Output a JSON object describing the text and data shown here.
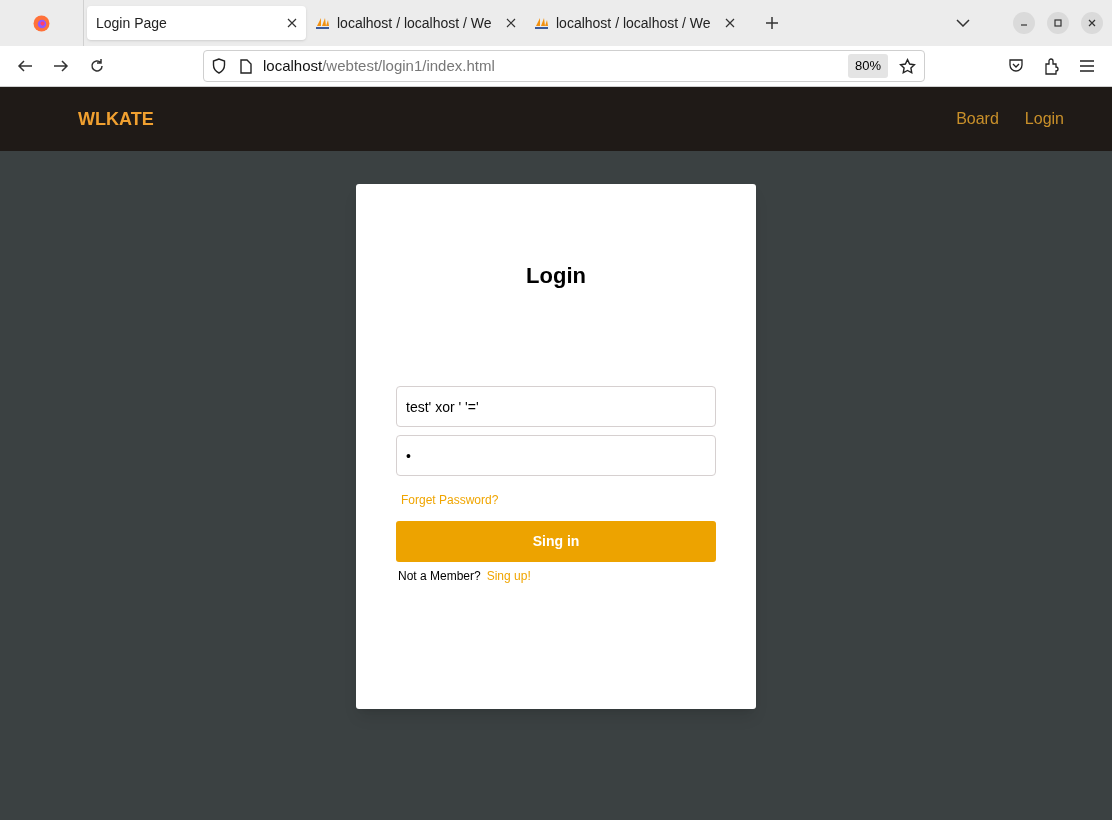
{
  "browser": {
    "tabs": [
      {
        "title": "Login Page",
        "kind": "page",
        "selected": true
      },
      {
        "title": "localhost / localhost / We",
        "kind": "pma",
        "selected": false
      },
      {
        "title": "localhost / localhost / We",
        "kind": "pma",
        "selected": false
      }
    ],
    "address": {
      "host": "localhost",
      "path": "/webtest/login1/index.html"
    },
    "zoom": "80%"
  },
  "navbar": {
    "brand": "WLKATE",
    "links": [
      "Board",
      "Login"
    ]
  },
  "login": {
    "title": "Login",
    "username": {
      "value": "test' xor ' '='"
    },
    "password": {
      "value": "•"
    },
    "forgot_link": "Forget Password?",
    "submit": "Sing in",
    "signup_prompt": "Not a Member?",
    "signup_link": "Sing up!"
  }
}
